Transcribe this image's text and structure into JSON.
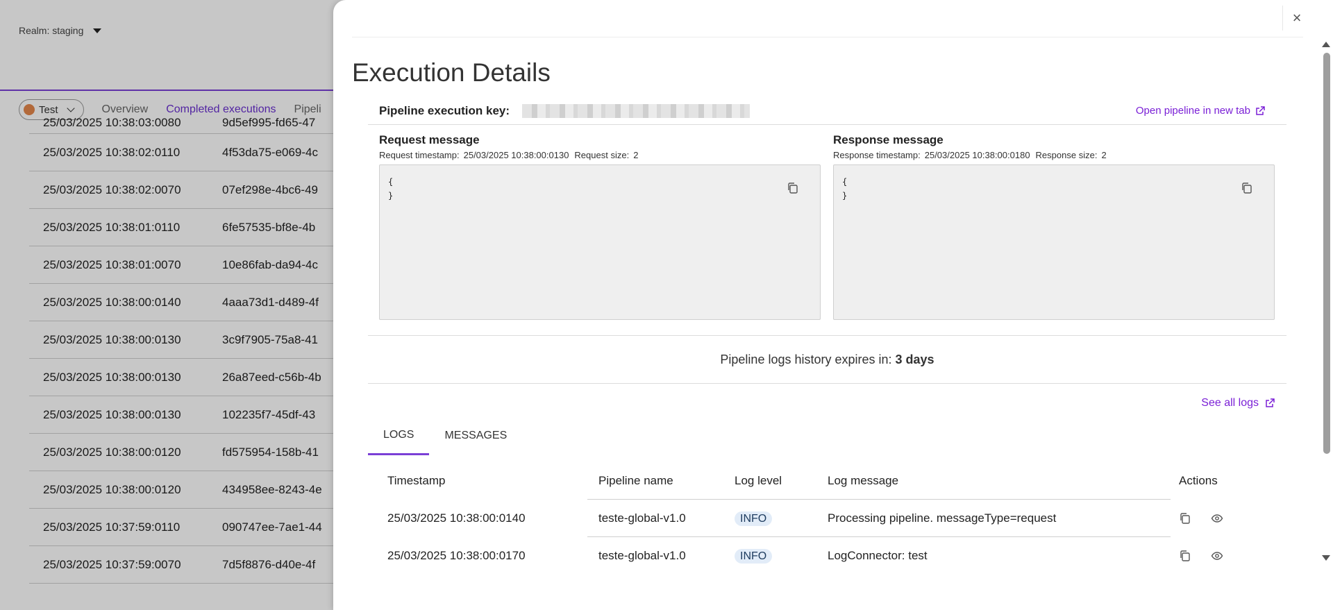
{
  "background": {
    "realm_label": "Realm: staging",
    "env_label": "Test",
    "tabs": [
      {
        "label": "Overview",
        "active": false
      },
      {
        "label": "Completed executions",
        "active": true
      },
      {
        "label": "Pipeli",
        "active": false
      }
    ],
    "partial_row": {
      "ts": "25/03/2025 10:38:03:0080",
      "id": "9d5ef995-fd65-47"
    },
    "rows": [
      {
        "ts": "25/03/2025 10:38:02:0110",
        "id": "4f53da75-e069-4c"
      },
      {
        "ts": "25/03/2025 10:38:02:0070",
        "id": "07ef298e-4bc6-49"
      },
      {
        "ts": "25/03/2025 10:38:01:0110",
        "id": "6fe57535-bf8e-4b"
      },
      {
        "ts": "25/03/2025 10:38:01:0070",
        "id": "10e86fab-da94-4c"
      },
      {
        "ts": "25/03/2025 10:38:00:0140",
        "id": "4aaa73d1-d489-4f"
      },
      {
        "ts": "25/03/2025 10:38:00:0130",
        "id": "3c9f7905-75a8-41"
      },
      {
        "ts": "25/03/2025 10:38:00:0130",
        "id": "26a87eed-c56b-4b"
      },
      {
        "ts": "25/03/2025 10:38:00:0130",
        "id": "102235f7-45df-43"
      },
      {
        "ts": "25/03/2025 10:38:00:0120",
        "id": "fd575954-158b-41"
      },
      {
        "ts": "25/03/2025 10:38:00:0120",
        "id": "434958ee-8243-4e"
      },
      {
        "ts": "25/03/2025 10:37:59:0110",
        "id": "090747ee-7ae1-44"
      },
      {
        "ts": "25/03/2025 10:37:59:0070",
        "id": "7d5f8876-d40e-4f"
      }
    ]
  },
  "drawer": {
    "title": "Execution Details",
    "close_icon": "×",
    "key_label": "Pipeline execution key:",
    "open_link": "Open pipeline in new tab",
    "request": {
      "title": "Request message",
      "ts_label": "Request timestamp:",
      "ts_value": "25/03/2025 10:38:00:0130",
      "size_label": "Request size:",
      "size_value": "2",
      "body_open": "{",
      "body_close": "}"
    },
    "response": {
      "title": "Response message",
      "ts_label": "Response timestamp:",
      "ts_value": "25/03/2025 10:38:00:0180",
      "size_label": "Response size:",
      "size_value": "2",
      "body_open": "{",
      "body_close": "}"
    },
    "expiry_text": "Pipeline logs history expires in:",
    "expiry_value": "3 days",
    "see_all": "See all logs",
    "tabs": [
      {
        "label": "LOGS",
        "active": true
      },
      {
        "label": "MESSAGES",
        "active": false
      }
    ],
    "logs": {
      "headers": {
        "timestamp": "Timestamp",
        "pipeline": "Pipeline name",
        "level": "Log level",
        "message": "Log message",
        "actions": "Actions"
      },
      "rows": [
        {
          "ts": "25/03/2025 10:38:00:0140",
          "pipeline": "teste-global-v1.0",
          "level": "INFO",
          "message": "Processing pipeline. messageType=request"
        },
        {
          "ts": "25/03/2025 10:38:00:0170",
          "pipeline": "teste-global-v1.0",
          "level": "INFO",
          "message": "LogConnector: test"
        }
      ]
    }
  },
  "colors": {
    "accent": "#7a1fd6",
    "tab_underline": "#7a3fd6",
    "badge_bg": "#e2ecf8",
    "env_dot": "#e5874b"
  },
  "icons": [
    "close-icon",
    "external-link-icon",
    "copy-icon",
    "eye-icon",
    "caret-down-icon",
    "chevron-down-icon"
  ]
}
